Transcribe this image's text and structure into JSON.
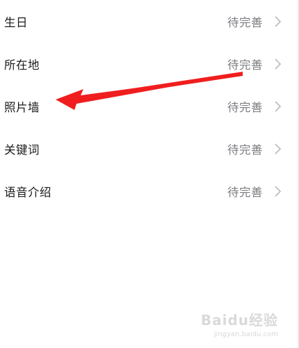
{
  "profile_fields": [
    {
      "label": "生日",
      "value": "待完善"
    },
    {
      "label": "所在地",
      "value": "待完善"
    },
    {
      "label": "照片墙",
      "value": "待完善"
    },
    {
      "label": "关键词",
      "value": "待完善"
    },
    {
      "label": "语音介绍",
      "value": "待完善"
    }
  ],
  "icons": {
    "row_chevron": "chevron-right-icon",
    "annotation": "red-arrow-pointer"
  },
  "colors": {
    "label_text": "#1b1b1b",
    "value_text": "#7d7d83",
    "chevron": "#b9b9be",
    "annotation_arrow": "#f01e1e",
    "background": "#ffffff"
  },
  "watermark": {
    "brand": "Baidu经验",
    "url": "jingyan.baidu.com"
  }
}
